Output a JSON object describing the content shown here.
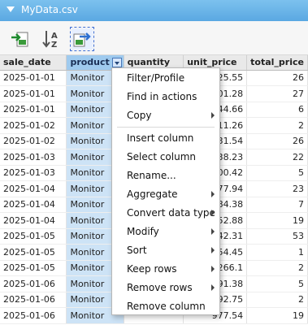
{
  "window": {
    "title": "MyData.csv"
  },
  "toolbar": {
    "icons": [
      "import-icon",
      "sort-az-icon",
      "export-icon"
    ]
  },
  "table": {
    "headers": [
      "sale_date",
      "product",
      "quantity",
      "unit_price",
      "total_price"
    ],
    "rows": [
      [
        "2025-01-01",
        "Monitor",
        "",
        "525.55",
        "26"
      ],
      [
        "2025-01-01",
        "Monitor",
        "",
        "901.28",
        "27"
      ],
      [
        "2025-01-01",
        "Monitor",
        "",
        "644.66",
        "6"
      ],
      [
        "2025-01-02",
        "Monitor",
        "",
        "411.26",
        "2"
      ],
      [
        "2025-01-02",
        "Monitor",
        "",
        "1331.54",
        "26"
      ],
      [
        "2025-01-03",
        "Monitor",
        "",
        "738.23",
        "22"
      ],
      [
        "2025-01-03",
        "Monitor",
        "",
        "500.42",
        "5"
      ],
      [
        "2025-01-04",
        "Monitor",
        "",
        "777.94",
        "23"
      ],
      [
        "2025-01-04",
        "Monitor",
        "",
        "784.38",
        "7"
      ],
      [
        "2025-01-04",
        "Monitor",
        "",
        "952.88",
        "19"
      ],
      [
        "2025-01-05",
        "Monitor",
        "",
        "1342.31",
        "53"
      ],
      [
        "2025-01-05",
        "Monitor",
        "",
        "854.45",
        "1"
      ],
      [
        "2025-01-05",
        "Monitor",
        "",
        "1266.1",
        "2"
      ],
      [
        "2025-01-06",
        "Monitor",
        "",
        "591.38",
        "5"
      ],
      [
        "2025-01-06",
        "Monitor",
        "",
        "1292.75",
        "2"
      ],
      [
        "2025-01-06",
        "Monitor",
        "",
        "977.54",
        "19"
      ]
    ]
  },
  "context_menu": {
    "items": [
      {
        "label": "Filter/Profile",
        "submenu": false
      },
      {
        "label": "Find in actions",
        "submenu": false
      },
      {
        "label": "Copy",
        "submenu": true
      },
      {
        "label": "Insert column",
        "submenu": false
      },
      {
        "label": "Select column",
        "submenu": false
      },
      {
        "label": "Rename...",
        "submenu": false
      },
      {
        "label": "Aggregate",
        "submenu": true
      },
      {
        "label": "Convert data type",
        "submenu": true
      },
      {
        "label": "Modify",
        "submenu": true
      },
      {
        "label": "Sort",
        "submenu": true
      },
      {
        "label": "Keep rows",
        "submenu": true
      },
      {
        "label": "Remove rows",
        "submenu": true
      },
      {
        "label": "Remove column",
        "submenu": false
      }
    ]
  },
  "colors": {
    "title_bar": "#5aa8e2",
    "selected_column": "#cde3f6",
    "selected_header": "#9fcaee"
  }
}
